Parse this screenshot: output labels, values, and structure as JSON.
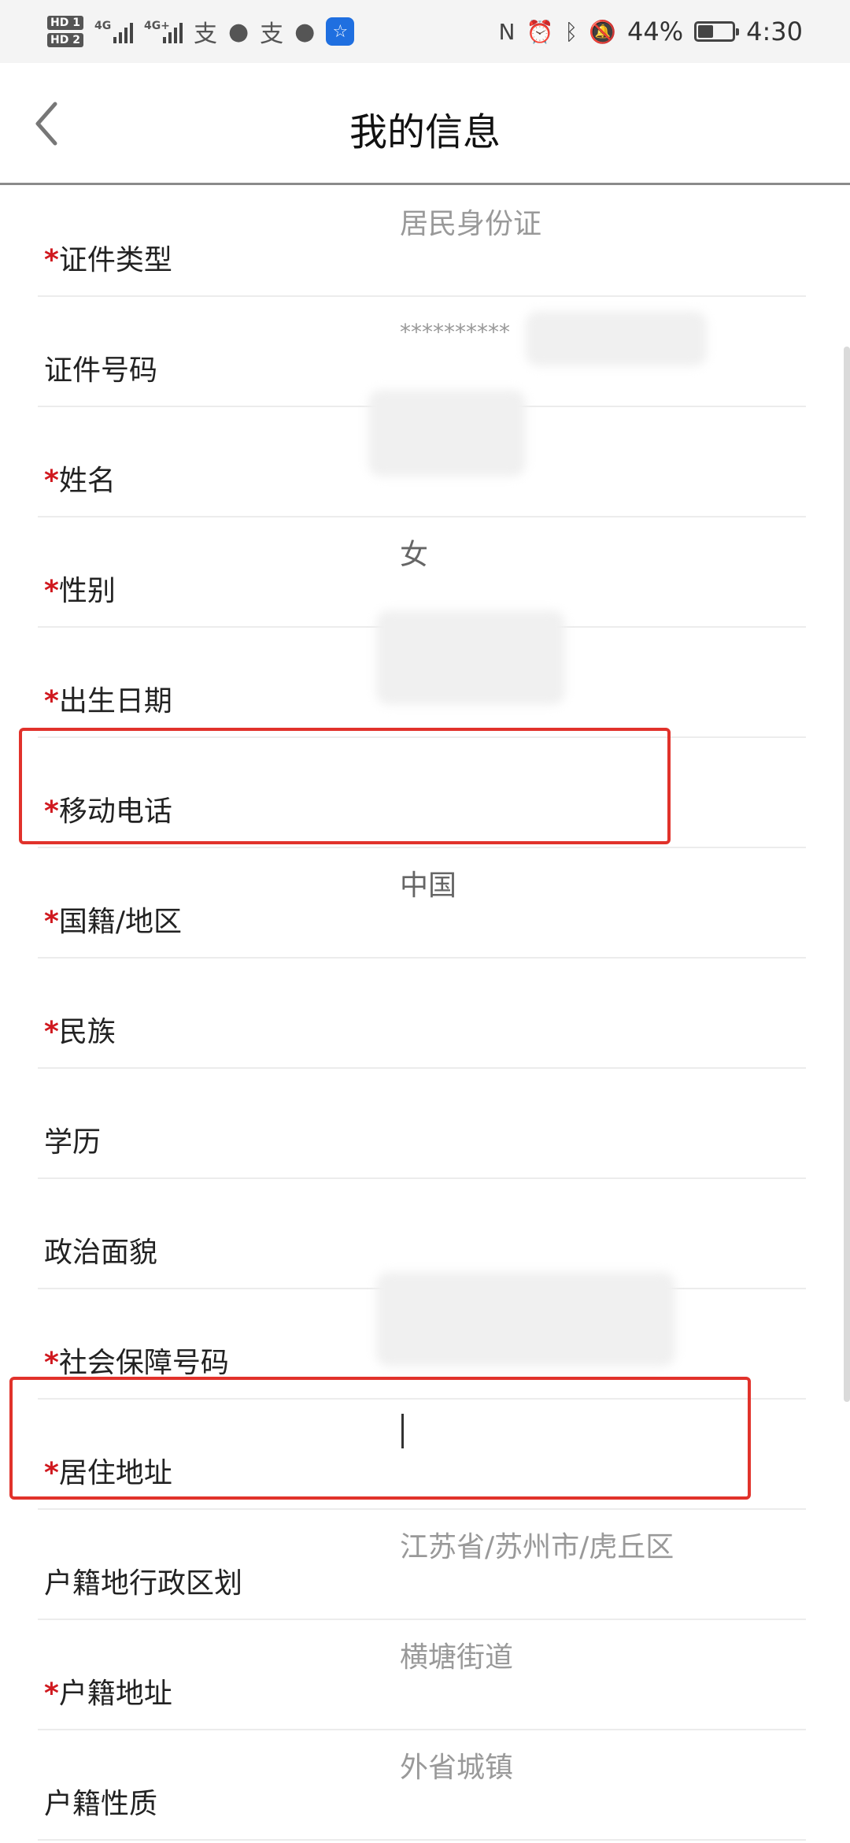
{
  "status_bar": {
    "sim1": "HD 1",
    "sim2": "HD 2",
    "net1": "4G",
    "net2": "4G+",
    "battery_text": "44%",
    "battery_level": 0.44,
    "time": "4:30",
    "icons": [
      "alipay-icon",
      "wechat-icon",
      "alipay-icon",
      "message-icon",
      "bulb-icon",
      "nfc-icon",
      "alarm-icon",
      "bluetooth-icon",
      "mute-icon",
      "battery-icon"
    ]
  },
  "header": {
    "title": "我的信息"
  },
  "fields": [
    {
      "label": "证件类型",
      "required": true,
      "value": "居民身份证"
    },
    {
      "label": "证件号码",
      "required": false,
      "value": "**********"
    },
    {
      "label": "姓名",
      "required": true,
      "value": ""
    },
    {
      "label": "性别",
      "required": true,
      "value": "女"
    },
    {
      "label": "出生日期",
      "required": true,
      "value": ""
    },
    {
      "label": "移动电话",
      "required": true,
      "value": ""
    },
    {
      "label": "国籍/地区",
      "required": true,
      "value": "中国"
    },
    {
      "label": "民族",
      "required": true,
      "value": ""
    },
    {
      "label": "学历",
      "required": false,
      "value": ""
    },
    {
      "label": "政治面貌",
      "required": false,
      "value": ""
    },
    {
      "label": "社会保障号码",
      "required": true,
      "value": ""
    },
    {
      "label": "居住地址",
      "required": true,
      "value": ""
    },
    {
      "label": "户籍地行政区划",
      "required": false,
      "value": "江苏省/苏州市/虎丘区"
    },
    {
      "label": "户籍地址",
      "required": true,
      "value": "横塘街道"
    },
    {
      "label": "户籍性质",
      "required": false,
      "value": "外省城镇"
    }
  ],
  "required_mark": "*",
  "highlight_color": "#e1322b",
  "required_color": "#d0191f"
}
